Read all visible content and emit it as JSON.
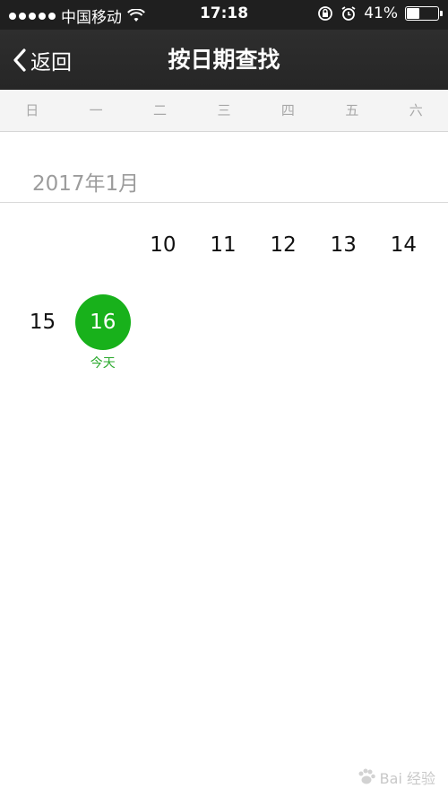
{
  "status_bar": {
    "carrier": "中国移动",
    "time": "17:18",
    "battery_percent": "41%",
    "battery_level": 0.41
  },
  "nav": {
    "back_label": "返回",
    "title": "按日期查找"
  },
  "weekdays": [
    "日",
    "一",
    "二",
    "三",
    "四",
    "五",
    "六"
  ],
  "calendar": {
    "month_title": "2017年1月",
    "rows": [
      [
        "",
        "",
        "",
        "10",
        "11",
        "12",
        "13",
        "14"
      ],
      [
        "15",
        "16"
      ]
    ],
    "today_label": "今天"
  },
  "watermark": "Bai 经验"
}
